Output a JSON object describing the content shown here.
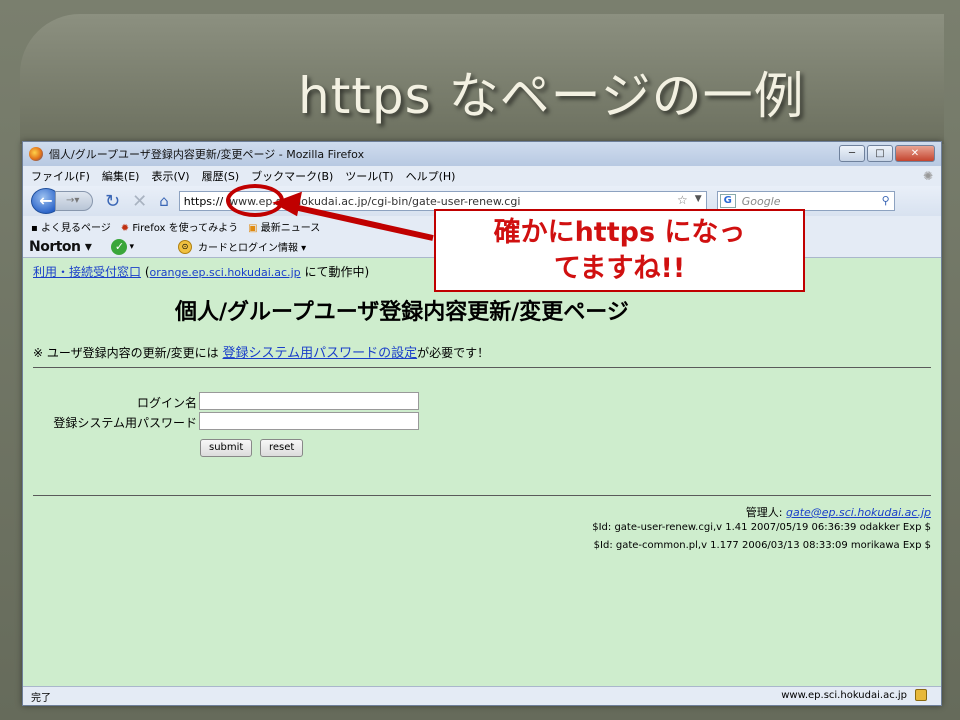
{
  "slide": {
    "title": "https なページの一例"
  },
  "window": {
    "title": "個人/グループユーザ登録内容更新/変更ページ - Mozilla Firefox",
    "buttons": {
      "minimize": "─",
      "maximize": "□",
      "close": "✕"
    }
  },
  "menu": [
    "ファイル(F)",
    "編集(E)",
    "表示(V)",
    "履歴(S)",
    "ブックマーク(B)",
    "ツール(T)",
    "ヘルプ(H)"
  ],
  "navbar": {
    "url_scheme": "https://",
    "url_rest": "www.ep.sci.hokudai.ac.jp/cgi-bin/gate-user-renew.cgi",
    "search_placeholder": "Google",
    "search_engine_icon": "G"
  },
  "bookmarks": [
    "よく見るページ",
    "Firefox を使ってみよう",
    "最新ニュース"
  ],
  "norton": {
    "logo": "Norton",
    "card_login": "カードとログイン情報"
  },
  "page": {
    "top_link_label": "利用・接続受付窓口",
    "top_link_host": "orange.ep.sci.hokudai.ac.jp",
    "top_link_suffix": "にて動作中)",
    "top_link_paren": "(",
    "heading": "個人/グループユーザ登録内容更新/変更ページ",
    "notice_prefix": "※ ユーザ登録内容の更新/変更には",
    "notice_link": "登録システム用パスワードの設定",
    "notice_suffix": "が必要です！",
    "label_login": "ログイン名",
    "label_password": "登録システム用パスワード",
    "submit": "submit",
    "reset": "reset",
    "admin_label": "管理人:",
    "admin_email": "gate@ep.sci.hokudai.ac.jp",
    "id_line_1": "$Id: gate-user-renew.cgi,v 1.41 2007/05/19 06:36:39 odakker Exp $",
    "id_line_2": "$Id: gate-common.pl,v 1.177 2006/03/13 08:33:09 morikawa Exp $"
  },
  "status": {
    "left": "完了",
    "right": "www.ep.sci.hokudai.ac.jp"
  },
  "annotation": {
    "line1": "確かにhttps になっ",
    "line2": "てますね!!"
  },
  "colors": {
    "annotation_red": "#c00000",
    "content_bg": "#ceedcd",
    "link_blue": "#1a3fc9"
  }
}
